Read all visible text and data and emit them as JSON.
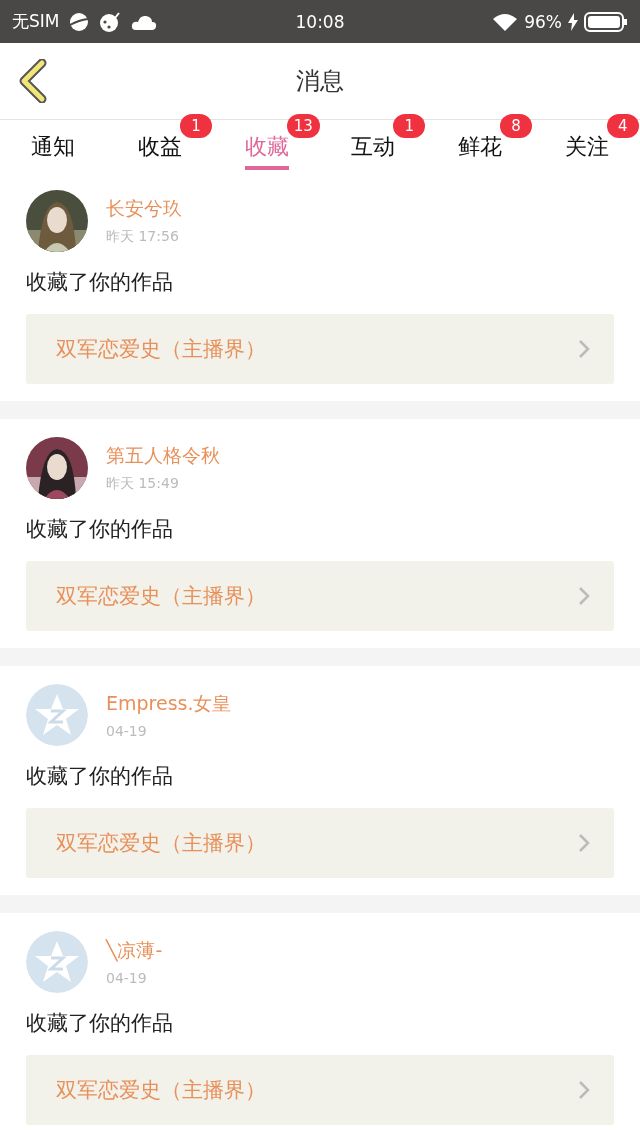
{
  "status_bar": {
    "carrier": "无SIM",
    "time": "10:08",
    "battery": "96%"
  },
  "header": {
    "title": "消息"
  },
  "tabs": [
    {
      "label": "通知",
      "selected": false
    },
    {
      "label": "收益",
      "selected": false,
      "badge": "1"
    },
    {
      "label": "收藏",
      "selected": true,
      "badge": "13"
    },
    {
      "label": "互动",
      "selected": false,
      "badge": "1"
    },
    {
      "label": "鲜花",
      "selected": false,
      "badge": "8"
    },
    {
      "label": "关注",
      "selected": false,
      "badge": "4"
    }
  ],
  "messages": [
    {
      "name": "长安兮玖",
      "time": "昨天 17:56",
      "text": "收藏了你的作品",
      "work": "双军恋爱史（主播界）"
    },
    {
      "name": "第五人格令秋",
      "time": "昨天 15:49",
      "text": "收藏了你的作品",
      "work": "双军恋爱史（主播界）"
    },
    {
      "avatar": {
        "kind": "default"
      },
      "name": "Empress.女皇",
      "time": "04-19",
      "text": "收藏了你的作品",
      "work": "双军恋爱史（主播界）"
    },
    {
      "avatar": {
        "kind": "default"
      },
      "name": "╲凉薄-",
      "time": "04-19",
      "text": "收藏了你的作品",
      "work": "双军恋爱史（主播界）"
    }
  ]
}
